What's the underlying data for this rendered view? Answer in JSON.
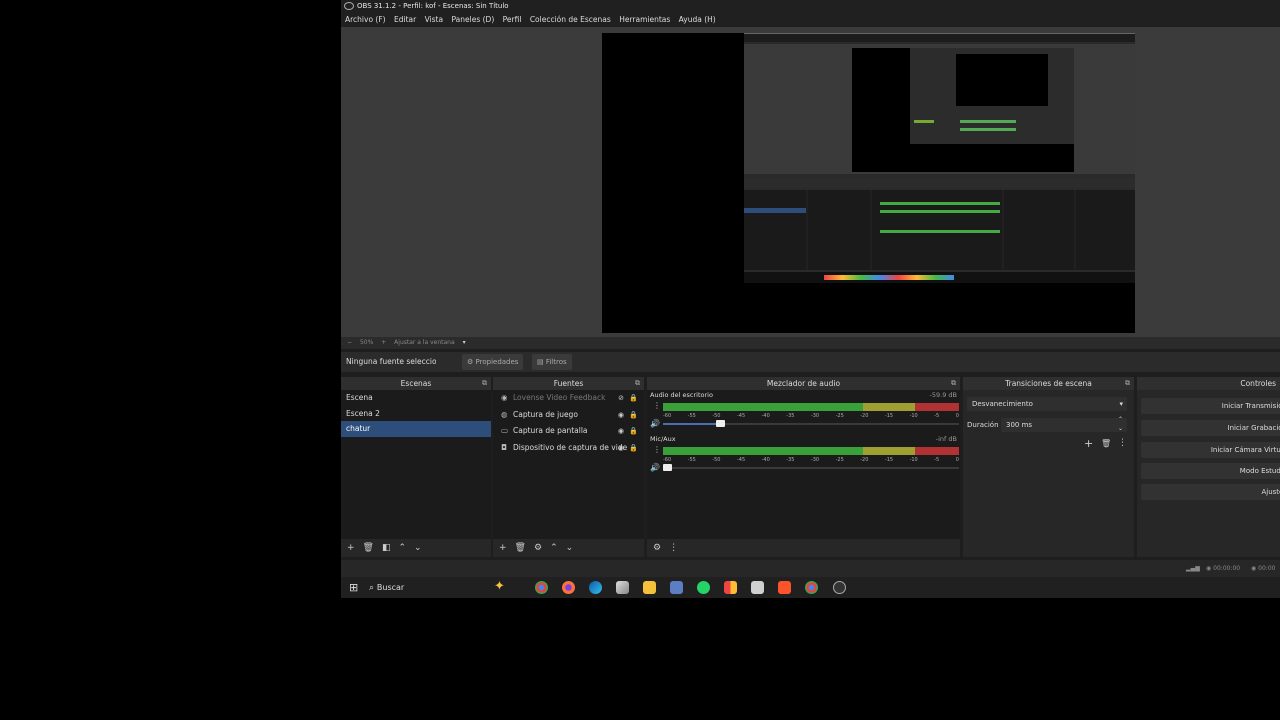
{
  "window": {
    "title": "OBS 31.1.2 - Perfil: kof - Escenas: Sin Título"
  },
  "menu": [
    "Archivo (F)",
    "Editar",
    "Vista",
    "Paneles (D)",
    "Perfil",
    "Colección de Escenas",
    "Herramientas",
    "Ayuda (H)"
  ],
  "zoom": {
    "minus": "−",
    "value": "50%",
    "plus": "+",
    "fit": "Ajustar a la ventana"
  },
  "source_toolbar": {
    "no_selection": "Ninguna fuente seleccionad",
    "properties": "Propiedades",
    "filters": "Filtros"
  },
  "docks": {
    "scenes": {
      "title": "Escenas",
      "items": [
        "Escena",
        "Escena 2",
        "chatur"
      ],
      "selected": 2
    },
    "sources": {
      "title": "Fuentes",
      "items": [
        {
          "name": "Lovense Video Feedback",
          "icon": "feedback-icon",
          "hidden": true
        },
        {
          "name": "Captura de juego",
          "icon": "gamepad-icon",
          "hidden": false
        },
        {
          "name": "Captura de pantalla",
          "icon": "monitor-icon",
          "hidden": false
        },
        {
          "name": "Dispositivo de captura de vide",
          "icon": "camera-icon",
          "hidden": false
        }
      ]
    },
    "mixer": {
      "title": "Mezclador de audio",
      "channels": [
        {
          "name": "Audio del escritorio",
          "db": "-59.9 dB",
          "volume": 0.18
        },
        {
          "name": "Mic/Aux",
          "db": "-inf dB",
          "volume": 0.0
        }
      ],
      "ticks": [
        "-60",
        "-55",
        "-50",
        "-45",
        "-40",
        "-35",
        "-30",
        "-25",
        "-20",
        "-15",
        "-10",
        "-5",
        "0"
      ]
    },
    "transitions": {
      "title": "Transiciones de escena",
      "selected": "Desvanecimiento",
      "duration_label": "Duración",
      "duration_value": "300 ms"
    },
    "controls": {
      "title": "Controles",
      "buttons": [
        "Iniciar Transmisión",
        "Iniciar Grabación",
        "Iniciar Cámara Virtual",
        "Modo Estudio",
        "Ajustes"
      ]
    }
  },
  "status": {
    "rec_time": "00:00:00",
    "stream_time": "00:00"
  },
  "taskbar": {
    "search": "Buscar"
  },
  "colors": {
    "accent": "#2d4d7a",
    "meter_green": "#3aa13a",
    "meter_yellow": "#a0a032",
    "meter_red": "#b03232"
  }
}
